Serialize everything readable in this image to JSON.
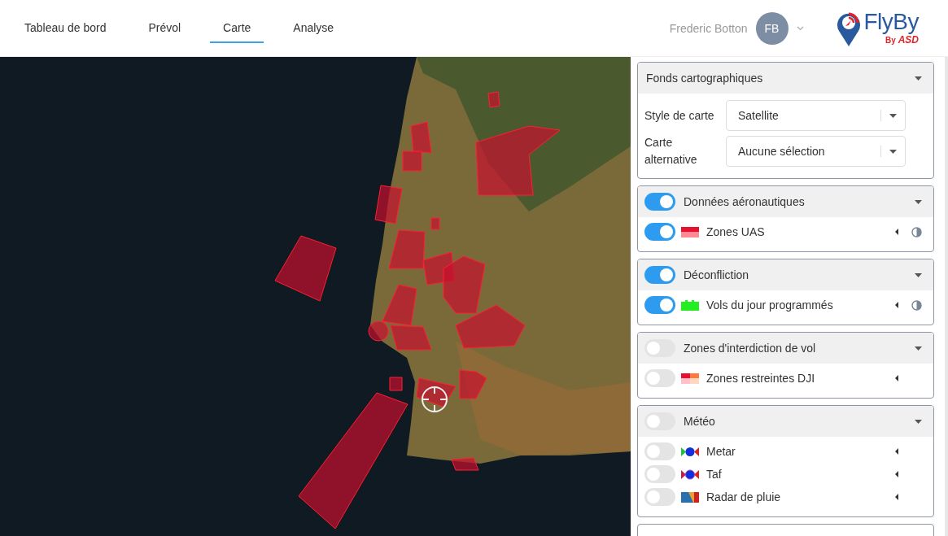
{
  "tabs": [
    {
      "label": "Tableau de bord",
      "selected": false
    },
    {
      "label": "Prévol",
      "selected": false
    },
    {
      "label": "Carte",
      "selected": true
    },
    {
      "label": "Analyse",
      "selected": false
    }
  ],
  "user": {
    "name": "Frederic Botton",
    "initials": "FB"
  },
  "logo": {
    "name": "FlyBy",
    "by": "By",
    "brand": "ASD"
  },
  "panels": [
    {
      "kind": "selects",
      "title": "Fonds cartographiques",
      "fields": [
        {
          "label": "Style de carte",
          "value": "Satellite"
        },
        {
          "label": "Carte alternative",
          "value": "Aucune sélection"
        }
      ]
    },
    {
      "kind": "layers",
      "title": "Données aéronautiques",
      "on": true,
      "layers": [
        {
          "label": "Zones UAS",
          "on": true,
          "kind": "uas",
          "opacity_control": true
        }
      ]
    },
    {
      "kind": "layers",
      "title": "Déconfliction",
      "on": true,
      "layers": [
        {
          "label": "Vols du jour programmés",
          "on": true,
          "kind": "flights",
          "opacity_control": true
        }
      ]
    },
    {
      "kind": "layers",
      "title": "Zones d'interdiction de vol",
      "on": false,
      "layers": [
        {
          "label": "Zones restreintes DJI",
          "on": false,
          "kind": "dji",
          "opacity_control": false
        }
      ]
    },
    {
      "kind": "layers",
      "title": "Météo",
      "on": false,
      "layers": [
        {
          "label": "Metar",
          "on": false,
          "kind": "metar",
          "opacity_control": false
        },
        {
          "label": "Taf",
          "on": false,
          "kind": "taf",
          "opacity_control": false
        },
        {
          "label": "Radar de pluie",
          "on": false,
          "kind": "radar",
          "opacity_control": false
        }
      ]
    }
  ]
}
